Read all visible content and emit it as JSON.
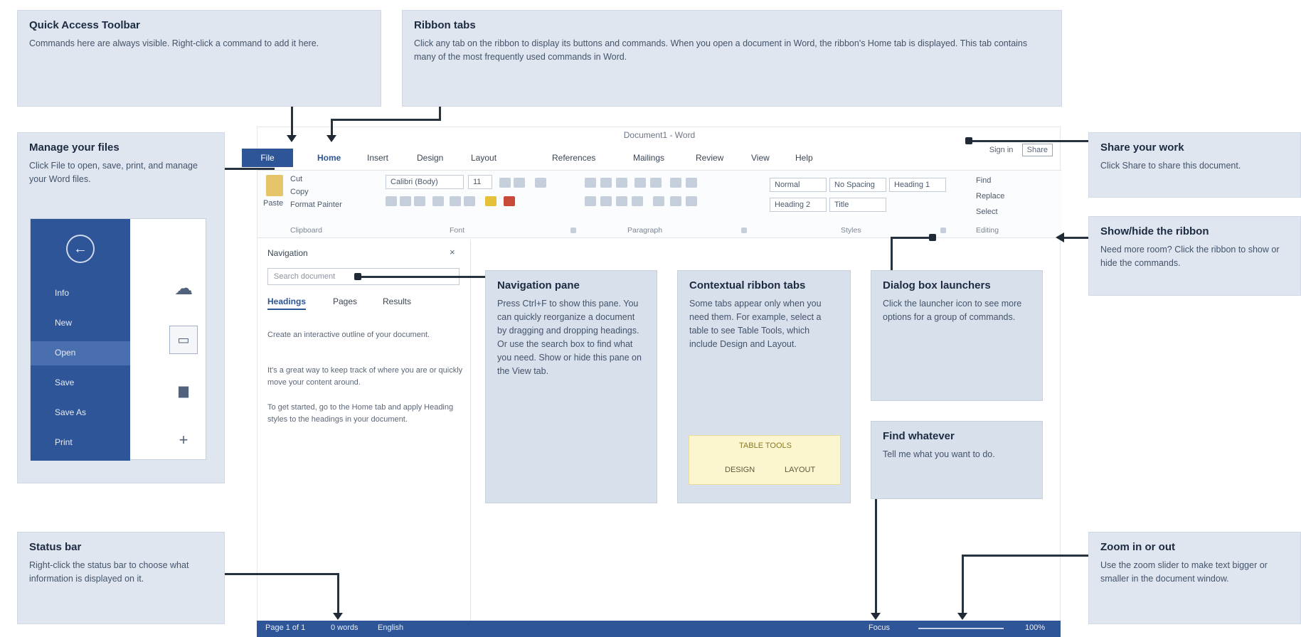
{
  "callouts": {
    "quick_access": {
      "title": "Quick Access Toolbar",
      "text": "Commands here are always visible. Right-click a command to add it here."
    },
    "ribbon_tabs": {
      "title": "Ribbon tabs",
      "text": "Click any tab on the ribbon to display its buttons and commands. When you open a document in Word, the ribbon's Home tab is displayed. This tab contains many of the most frequently used commands in Word."
    },
    "manage_files": {
      "title": "Manage your files",
      "text": "Click File to open, save, print, and manage your Word files."
    },
    "share": {
      "title": "Share your work",
      "text": "Click Share to share this document."
    },
    "show_hide_ribbon": {
      "title": "Show/hide the ribbon",
      "text": "Need more room? Click the ribbon to show or hide the commands."
    },
    "navigation_pane": {
      "title": "Navigation pane",
      "text": "Press Ctrl+F to show this pane. You can quickly reorganize a document by dragging and dropping headings. Or use the search box to find what you need. Show or hide this pane on the View tab."
    },
    "contextual_tabs": {
      "title": "Contextual ribbon tabs",
      "text": "Some tabs appear only when you need them. For example, select a table to see Table Tools, which include Design and Layout."
    },
    "dialog_launchers": {
      "title": "Dialog box launchers",
      "text": "Click the launcher icon to see more options for a group of commands."
    },
    "status_bar": {
      "title": "Status bar",
      "text": "Right-click the status bar to choose what information is displayed on it."
    },
    "zoom": {
      "title": "Zoom in or out",
      "text": "Use the zoom slider to make text bigger or smaller in the document window."
    },
    "find_whatever": {
      "title": "Find whatever",
      "text": "Tell me what you want to do."
    }
  },
  "backstage": {
    "items": [
      "Info",
      "New",
      "Open",
      "Save",
      "Save As",
      "Print"
    ],
    "selected_index": 2,
    "back_icon": "back-arrow-icon",
    "side_icons": [
      "cloud-icon",
      "folder-icon",
      "computer-icon",
      "plus-icon"
    ]
  },
  "window": {
    "title": "Document1 - Word",
    "right_cmds": [
      "Sign in",
      "Share"
    ],
    "tabs": [
      "File",
      "Home",
      "Insert",
      "Design",
      "Layout",
      "References",
      "Mailings",
      "Review",
      "View",
      "Help"
    ],
    "ribbon": {
      "paste": "Paste",
      "clipboard_cmds": [
        "Cut",
        "Copy",
        "Format Painter"
      ],
      "font_name": "Calibri (Body)",
      "font_size": "11",
      "styles": [
        "Normal",
        "No Spacing",
        "Heading 1",
        "Heading 2",
        "Title"
      ],
      "editing": [
        "Find",
        "Replace",
        "Select"
      ],
      "groups": [
        "Clipboard",
        "Font",
        "Paragraph",
        "Styles",
        "Editing"
      ]
    },
    "nav_pane": {
      "title": "Navigation",
      "close": "×",
      "search_placeholder": "Search document",
      "tabs": [
        "Headings",
        "Pages",
        "Results"
      ],
      "paras": [
        "Create an interactive outline of your document.",
        "It's a great way to keep track of where you are or quickly move your content around.",
        "To get started, go to the Home tab and apply Heading styles to the headings in your document."
      ]
    },
    "yellow_box": {
      "title": "TABLE TOOLS",
      "tabs": [
        "DESIGN",
        "LAYOUT"
      ]
    },
    "status": {
      "left": [
        "Page 1 of 1",
        "0 words",
        "English"
      ],
      "right": [
        "Focus",
        "100%"
      ]
    }
  }
}
